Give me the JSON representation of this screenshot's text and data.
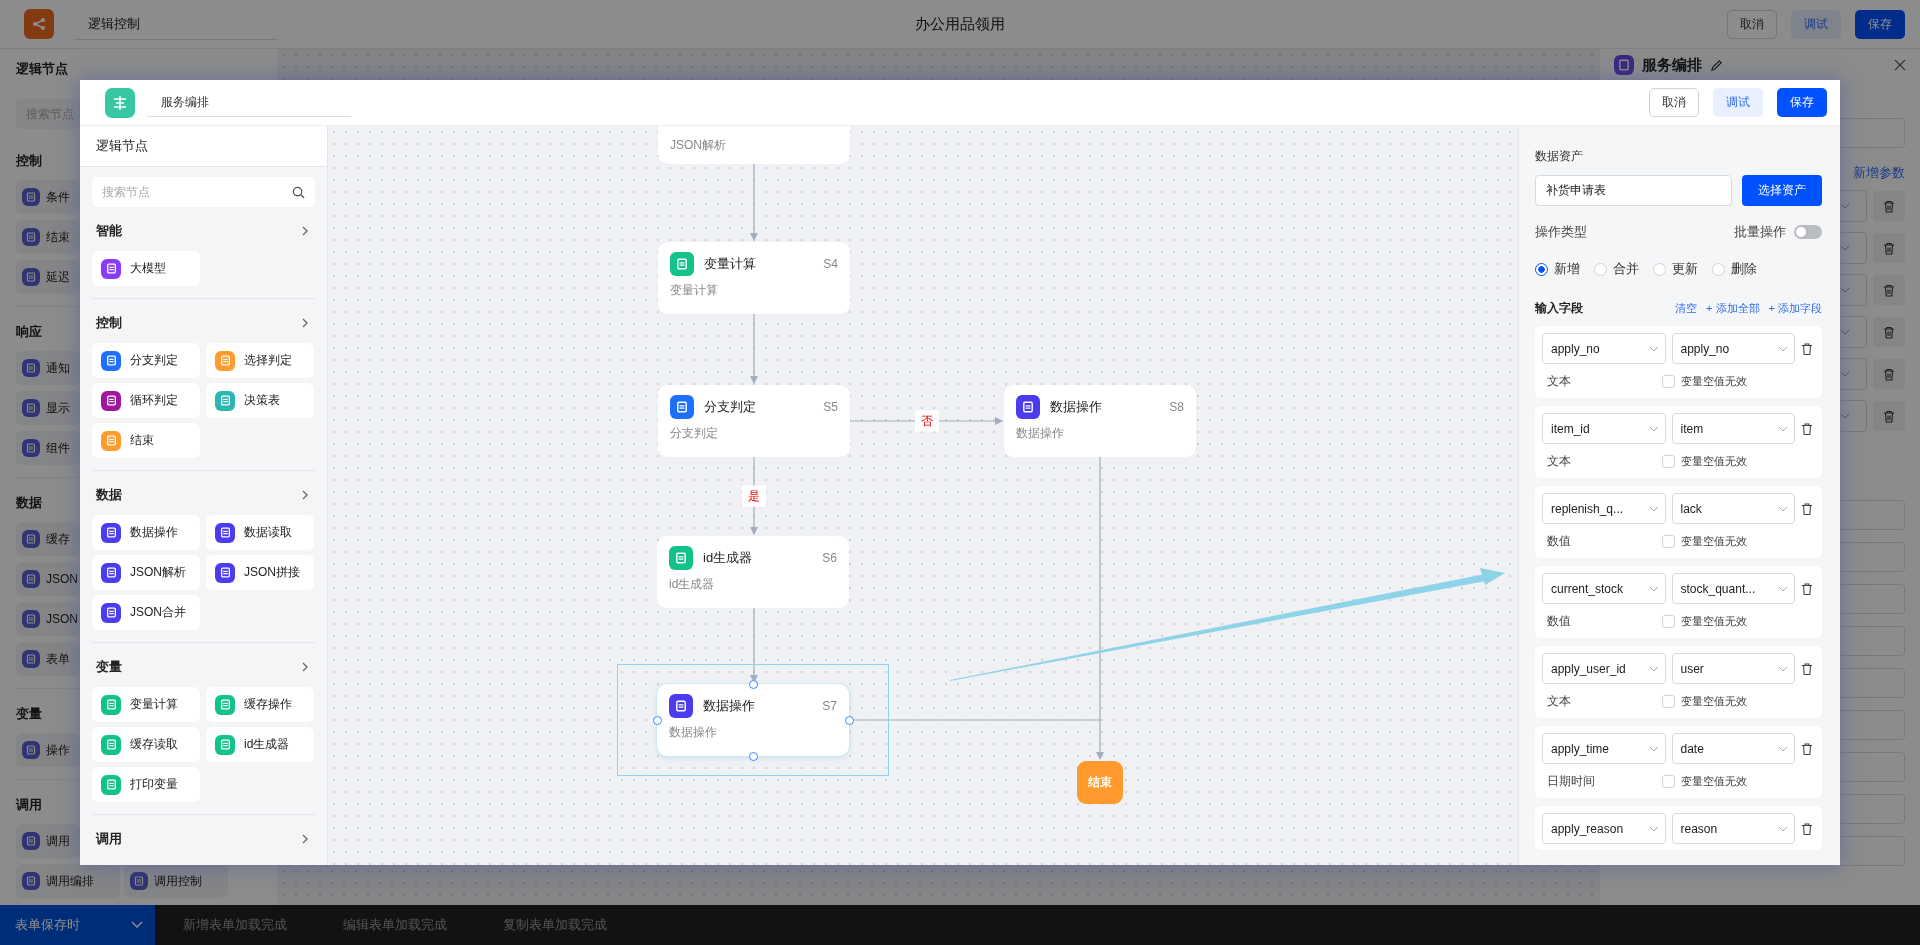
{
  "app_bar": {
    "title_field": "逻辑控制",
    "page_title": "办公用品领用",
    "buttons": [
      {
        "label": "取消",
        "kind": "outline"
      },
      {
        "label": "调试",
        "kind": "light"
      },
      {
        "label": "保存",
        "kind": "primary"
      }
    ]
  },
  "background_sidebar": {
    "title": "逻辑节点",
    "search_placeholder": "搜索节点",
    "sections": [
      {
        "title": "控制",
        "rows": [
          [
            {
              "label": "条件"
            }
          ],
          [
            {
              "label": "结束"
            }
          ],
          [
            {
              "label": "延迟"
            }
          ]
        ]
      },
      {
        "title": "响应",
        "rows": [
          [
            {
              "label": "通知"
            }
          ],
          [
            {
              "label": "显示"
            }
          ],
          [
            {
              "label": "组件"
            }
          ]
        ]
      },
      {
        "title": "数据",
        "rows": [
          [
            {
              "label": "缓存"
            }
          ],
          [
            {
              "label": "JSON"
            }
          ],
          [
            {
              "label": "JSON"
            }
          ],
          [
            {
              "label": "表单"
            }
          ]
        ]
      },
      {
        "title": "变量",
        "rows": [
          [
            {
              "label": "操作"
            }
          ]
        ]
      },
      {
        "title": "调用",
        "rows": [
          [
            {
              "label": "调用"
            }
          ],
          [
            {
              "label": "调用编排"
            },
            {
              "label": "调用控制"
            }
          ]
        ]
      }
    ]
  },
  "background_panel": {
    "title": "服务编排",
    "action": "新增参数"
  },
  "event_tabs": [
    {
      "label": "表单保存时",
      "selected": true
    },
    {
      "label": "新增表单加载完成",
      "selected": false
    },
    {
      "label": "编辑表单加载完成",
      "selected": false
    },
    {
      "label": "复制表单加载完成",
      "selected": false
    }
  ],
  "dialog": {
    "title_field": "服务编排",
    "buttons": [
      {
        "label": "取消",
        "kind": "outline"
      },
      {
        "label": "调试",
        "kind": "light"
      },
      {
        "label": "保存",
        "kind": "primary"
      }
    ],
    "node_panel": {
      "title": "逻辑节点",
      "search_placeholder": "搜索节点",
      "sections": [
        {
          "title": "智能",
          "items": [
            {
              "label": "大模型",
              "color": "#8b3cf7"
            }
          ]
        },
        {
          "title": "控制",
          "items": [
            {
              "label": "分支判定",
              "color": "#1e6fff"
            },
            {
              "label": "选择判定",
              "color": "#ff9a2e"
            },
            {
              "label": "循环判定",
              "color": "#a0169e"
            },
            {
              "label": "决策表",
              "color": "#2bb6b0"
            },
            {
              "label": "结束",
              "color": "#ff9a2e"
            }
          ]
        },
        {
          "title": "数据",
          "items": [
            {
              "label": "数据操作",
              "color": "#4b3cf0"
            },
            {
              "label": "数据读取",
              "color": "#4b3cf0"
            },
            {
              "label": "JSON解析",
              "color": "#4b3cf0"
            },
            {
              "label": "JSON拼接",
              "color": "#4b3cf0"
            },
            {
              "label": "JSON合并",
              "color": "#4b3cf0"
            }
          ]
        },
        {
          "title": "变量",
          "items": [
            {
              "label": "变量计算",
              "color": "#12c28a"
            },
            {
              "label": "缓存操作",
              "color": "#12c28a"
            },
            {
              "label": "缓存读取",
              "color": "#12c28a"
            },
            {
              "label": "id生成器",
              "color": "#12c28a"
            },
            {
              "label": "打印变量",
              "color": "#12c28a"
            }
          ]
        },
        {
          "title": "调用"
        }
      ]
    },
    "canvas": {
      "nodes": [
        {
          "kind": "tail",
          "subtitle": "JSON解析",
          "selected": false
        },
        {
          "kind": "step",
          "title": "变量计算",
          "code": "S4",
          "subtitle": "变量计算",
          "color": "#12c28a",
          "selected": false
        },
        {
          "kind": "step",
          "title": "分支判定",
          "code": "S5",
          "subtitle": "分支判定",
          "color": "#1e6fff",
          "selected": false
        },
        {
          "kind": "step",
          "title": "数据操作",
          "code": "S8",
          "subtitle": "数据操作",
          "color": "#4b3cf0",
          "selected": false
        },
        {
          "kind": "step",
          "title": "id生成器",
          "code": "S6",
          "subtitle": "id生成器",
          "color": "#12c28a",
          "selected": false
        },
        {
          "kind": "step",
          "title": "数据操作",
          "code": "S7",
          "subtitle": "数据操作",
          "color": "#4b3cf0",
          "selected": true
        },
        {
          "kind": "end",
          "title": "结束",
          "selected": false
        }
      ],
      "edge_labels": [
        "否",
        "是"
      ]
    },
    "properties": {
      "asset_label": "数据资产",
      "asset_value": "补货申请表",
      "asset_button": "选择资产",
      "op_label": "操作类型",
      "batch_label": "批量操作",
      "batch_on": false,
      "op_types": [
        {
          "label": "新增",
          "selected": true
        },
        {
          "label": "合并",
          "selected": false
        },
        {
          "label": "更新",
          "selected": false
        },
        {
          "label": "删除",
          "selected": false
        }
      ],
      "fields_label": "输入字段",
      "field_actions": [
        "清空",
        "+ 添加全部",
        "+ 添加字段"
      ],
      "fields": [
        {
          "source": "apply_no",
          "target": "apply_no",
          "type": "文本",
          "null_label": "变量空值无效",
          "checked": false
        },
        {
          "source": "item_id",
          "target": "item",
          "type": "文本",
          "null_label": "变量空值无效",
          "checked": false
        },
        {
          "source": "replenish_q...",
          "target": "lack",
          "type": "数值",
          "null_label": "变量空值无效",
          "checked": false
        },
        {
          "source": "current_stock",
          "target": "stock_quant...",
          "type": "数值",
          "null_label": "变量空值无效",
          "checked": false
        },
        {
          "source": "apply_user_id",
          "target": "user",
          "type": "文本",
          "null_label": "变量空值无效",
          "checked": false
        },
        {
          "source": "apply_time",
          "target": "date",
          "type": "日期时间",
          "null_label": "变量空值无效",
          "checked": false
        },
        {
          "source": "apply_reason",
          "target": "reason"
        }
      ]
    }
  }
}
